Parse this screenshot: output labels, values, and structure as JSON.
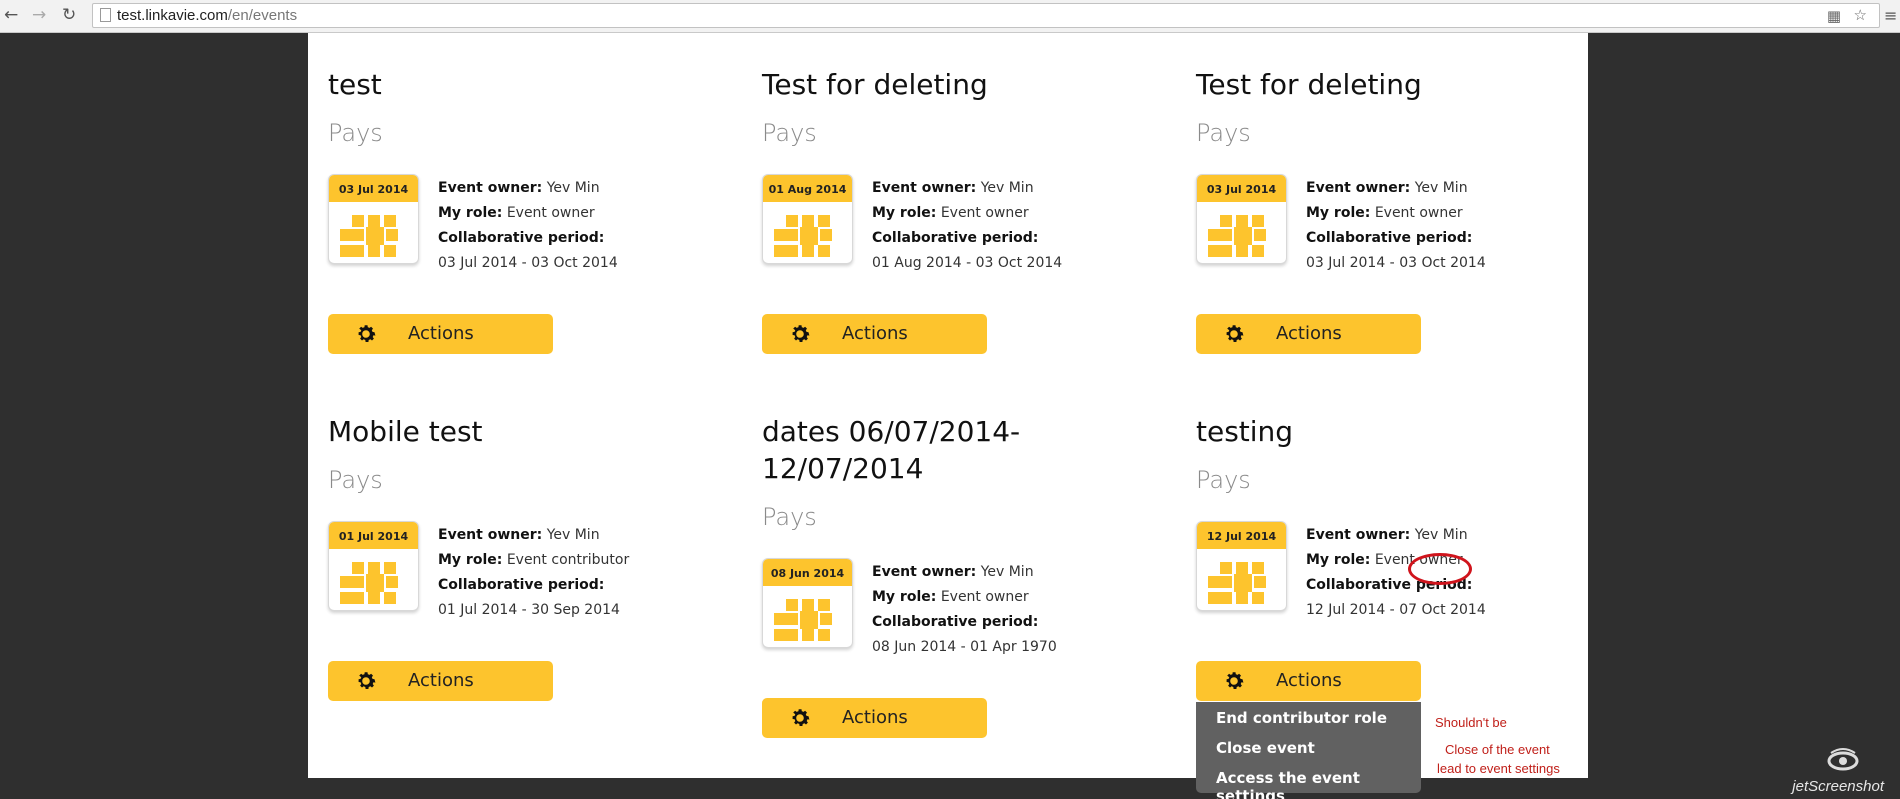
{
  "browser": {
    "url_domain": "test.linkavie.com",
    "url_path": "/en/events"
  },
  "events": [
    {
      "title": "test",
      "subtitle": "Pays",
      "date": "03 Jul 2014",
      "owner_label": "Event owner:",
      "owner": "Yev Min",
      "role_label": "My role:",
      "role": "Event owner",
      "period_label": "Collaborative period:",
      "period": "03 Jul 2014 - 03 Oct 2014",
      "actions_label": "Actions"
    },
    {
      "title": "Test for deleting",
      "subtitle": "Pays",
      "date": "01 Aug 2014",
      "owner_label": "Event owner:",
      "owner": "Yev Min",
      "role_label": "My role:",
      "role": "Event owner",
      "period_label": "Collaborative period:",
      "period": "01 Aug 2014 - 03 Oct 2014",
      "actions_label": "Actions"
    },
    {
      "title": "Test for deleting",
      "subtitle": "Pays",
      "date": "03 Jul 2014",
      "owner_label": "Event owner:",
      "owner": "Yev Min",
      "role_label": "My role:",
      "role": "Event owner",
      "period_label": "Collaborative period:",
      "period": "03 Jul 2014 - 03 Oct 2014",
      "actions_label": "Actions"
    },
    {
      "title": "Mobile test",
      "subtitle": "Pays",
      "date": "01 Jul 2014",
      "owner_label": "Event owner:",
      "owner": "Yev Min",
      "role_label": "My role:",
      "role": "Event contributor",
      "period_label": "Collaborative period:",
      "period": "01 Jul 2014 - 30 Sep 2014",
      "actions_label": "Actions"
    },
    {
      "title": "dates 06/07/2014-",
      "title_line2": "12/07/2014",
      "subtitle": "Pays",
      "date": "08 Jun 2014",
      "owner_label": "Event owner:",
      "owner": "Yev Min",
      "role_label": "My role:",
      "role": "Event owner",
      "period_label": "Collaborative period:",
      "period": "08 Jun 2014 - 01 Apr 1970",
      "actions_label": "Actions"
    },
    {
      "title": "testing",
      "subtitle": "Pays",
      "date": "12 Jul 2014",
      "owner_label": "Event owner:",
      "owner": "Yev Min",
      "role_label": "My role:",
      "role": "Event owner",
      "period_label": "Collaborative period:",
      "period": "12 Jul 2014 - 07 Oct 2014",
      "actions_label": "Actions"
    }
  ],
  "dropdown": {
    "items": [
      "End contributor role",
      "Close event",
      "Access the event settings"
    ]
  },
  "annotations": {
    "note1": "Shouldn't be",
    "note2_line1": "Close of the event",
    "note2_line2": "lead to event settings"
  },
  "watermark": "jetScreenshot",
  "colors": {
    "accent": "#fdc42d",
    "menu_bg": "#616161",
    "annotation": "#d0141c"
  }
}
